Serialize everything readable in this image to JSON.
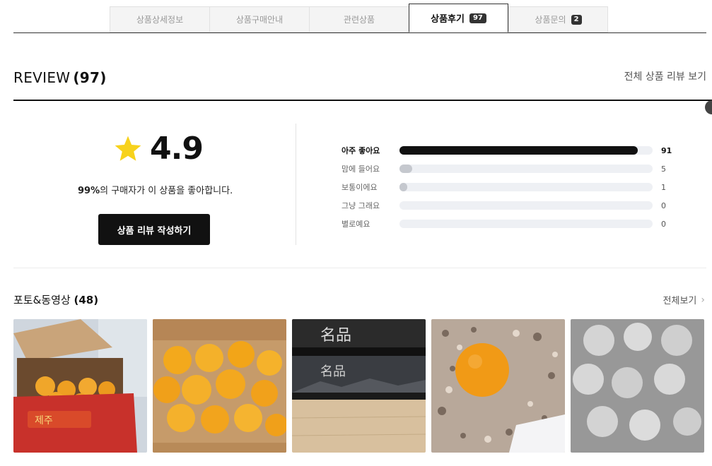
{
  "tabs": [
    {
      "label": "상품상세정보",
      "badge": ""
    },
    {
      "label": "상품구매안내",
      "badge": ""
    },
    {
      "label": "관련상품",
      "badge": ""
    },
    {
      "label": "상품후기",
      "badge": "97"
    },
    {
      "label": "상품문의",
      "badge": "2"
    }
  ],
  "review": {
    "title": "REVIEW",
    "count": "(97)",
    "all_link": "전체 상품 리뷰 보기"
  },
  "score": {
    "value": "4.9",
    "satisfaction_pct": "99%",
    "satisfaction_text": "의 구매자가 이 상품을 좋아합니다.",
    "write_button": "상품 리뷰 작성하기"
  },
  "ratings": [
    {
      "label": "아주 좋아요",
      "count": "91",
      "fill_fraction": 0.94
    },
    {
      "label": "맘에 들어요",
      "count": "5",
      "fill_fraction": 0.05
    },
    {
      "label": "보통이에요",
      "count": "1",
      "fill_fraction": 0.03
    },
    {
      "label": "그냥 그래요",
      "count": "0",
      "fill_fraction": 0
    },
    {
      "label": "별로예요",
      "count": "0",
      "fill_fraction": 0
    }
  ],
  "photos_section": {
    "title": "포토&동영상",
    "count": "(48)",
    "view_all": "전체보기",
    "photos": [
      {
        "icon": "orange-box-photo"
      },
      {
        "icon": "oranges-in-box-photo"
      },
      {
        "icon": "product-box-lid-photo"
      },
      {
        "icon": "single-orange-photo"
      },
      {
        "icon": "wrapped-oranges-photo"
      }
    ]
  },
  "colors": {
    "accent": "#111111",
    "star": "#f7d21c",
    "bar_track": "#eef0f4",
    "bar_fill": "#c5c8ce"
  }
}
